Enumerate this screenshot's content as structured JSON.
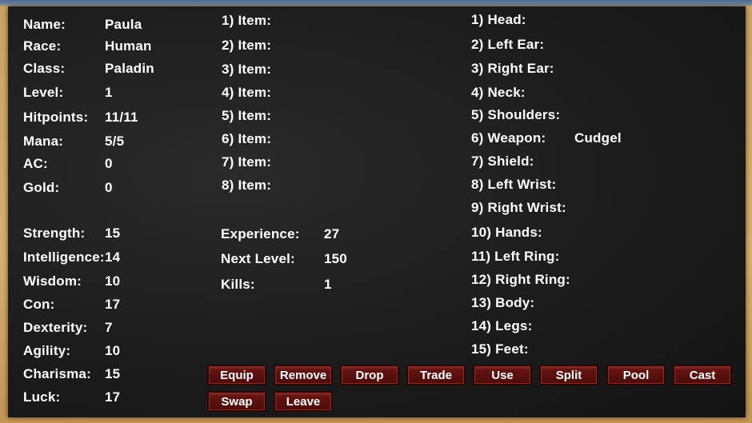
{
  "character": {
    "fields": [
      {
        "label": "Name:",
        "value": "Paula"
      },
      {
        "label": "Race:",
        "value": "Human"
      },
      {
        "label": "Class:",
        "value": "Paladin"
      },
      {
        "label": "Level:",
        "value": "1"
      },
      {
        "label": "Hitpoints:",
        "value": "11/11"
      },
      {
        "label": "Mana:",
        "value": "5/5"
      },
      {
        "label": "AC:",
        "value": "0"
      },
      {
        "label": "Gold:",
        "value": "0"
      }
    ],
    "attributes": [
      {
        "label": "Strength:",
        "value": "15"
      },
      {
        "label": "Intelligence:",
        "value": "14"
      },
      {
        "label": "Wisdom:",
        "value": "10"
      },
      {
        "label": "Con:",
        "value": "17"
      },
      {
        "label": "Dexterity:",
        "value": "7"
      },
      {
        "label": "Agility:",
        "value": "10"
      },
      {
        "label": "Charisma:",
        "value": "15"
      },
      {
        "label": "Luck:",
        "value": "17"
      }
    ]
  },
  "inventory": {
    "items": [
      "1) Item:",
      "2) Item:",
      "3) Item:",
      "4) Item:",
      "5) Item:",
      "6) Item:",
      "7) Item:",
      "8) Item:"
    ]
  },
  "progress": [
    {
      "label": "Experience:",
      "value": "27"
    },
    {
      "label": "Next Level:",
      "value": "150"
    },
    {
      "label": "Kills:",
      "value": "1"
    }
  ],
  "equipment": [
    {
      "label": "1) Head:",
      "value": ""
    },
    {
      "label": "2) Left Ear:",
      "value": ""
    },
    {
      "label": "3) Right Ear:",
      "value": ""
    },
    {
      "label": "4) Neck:",
      "value": ""
    },
    {
      "label": "5) Shoulders:",
      "value": ""
    },
    {
      "label": "6) Weapon:",
      "value": "Cudgel"
    },
    {
      "label": "7) Shield:",
      "value": ""
    },
    {
      "label": "8) Left Wrist:",
      "value": ""
    },
    {
      "label": "9) Right Wrist:",
      "value": ""
    },
    {
      "label": "10) Hands:",
      "value": ""
    },
    {
      "label": "11) Left Ring:",
      "value": ""
    },
    {
      "label": "12) Right Ring:",
      "value": ""
    },
    {
      "label": "13) Body:",
      "value": ""
    },
    {
      "label": "14) Legs:",
      "value": ""
    },
    {
      "label": "15) Feet:",
      "value": ""
    }
  ],
  "actions": {
    "row1": [
      "Equip",
      "Remove",
      "Drop",
      "Trade",
      "Use",
      "Split",
      "Pool",
      "Cast"
    ],
    "row2": [
      "Swap",
      "Leave"
    ]
  }
}
